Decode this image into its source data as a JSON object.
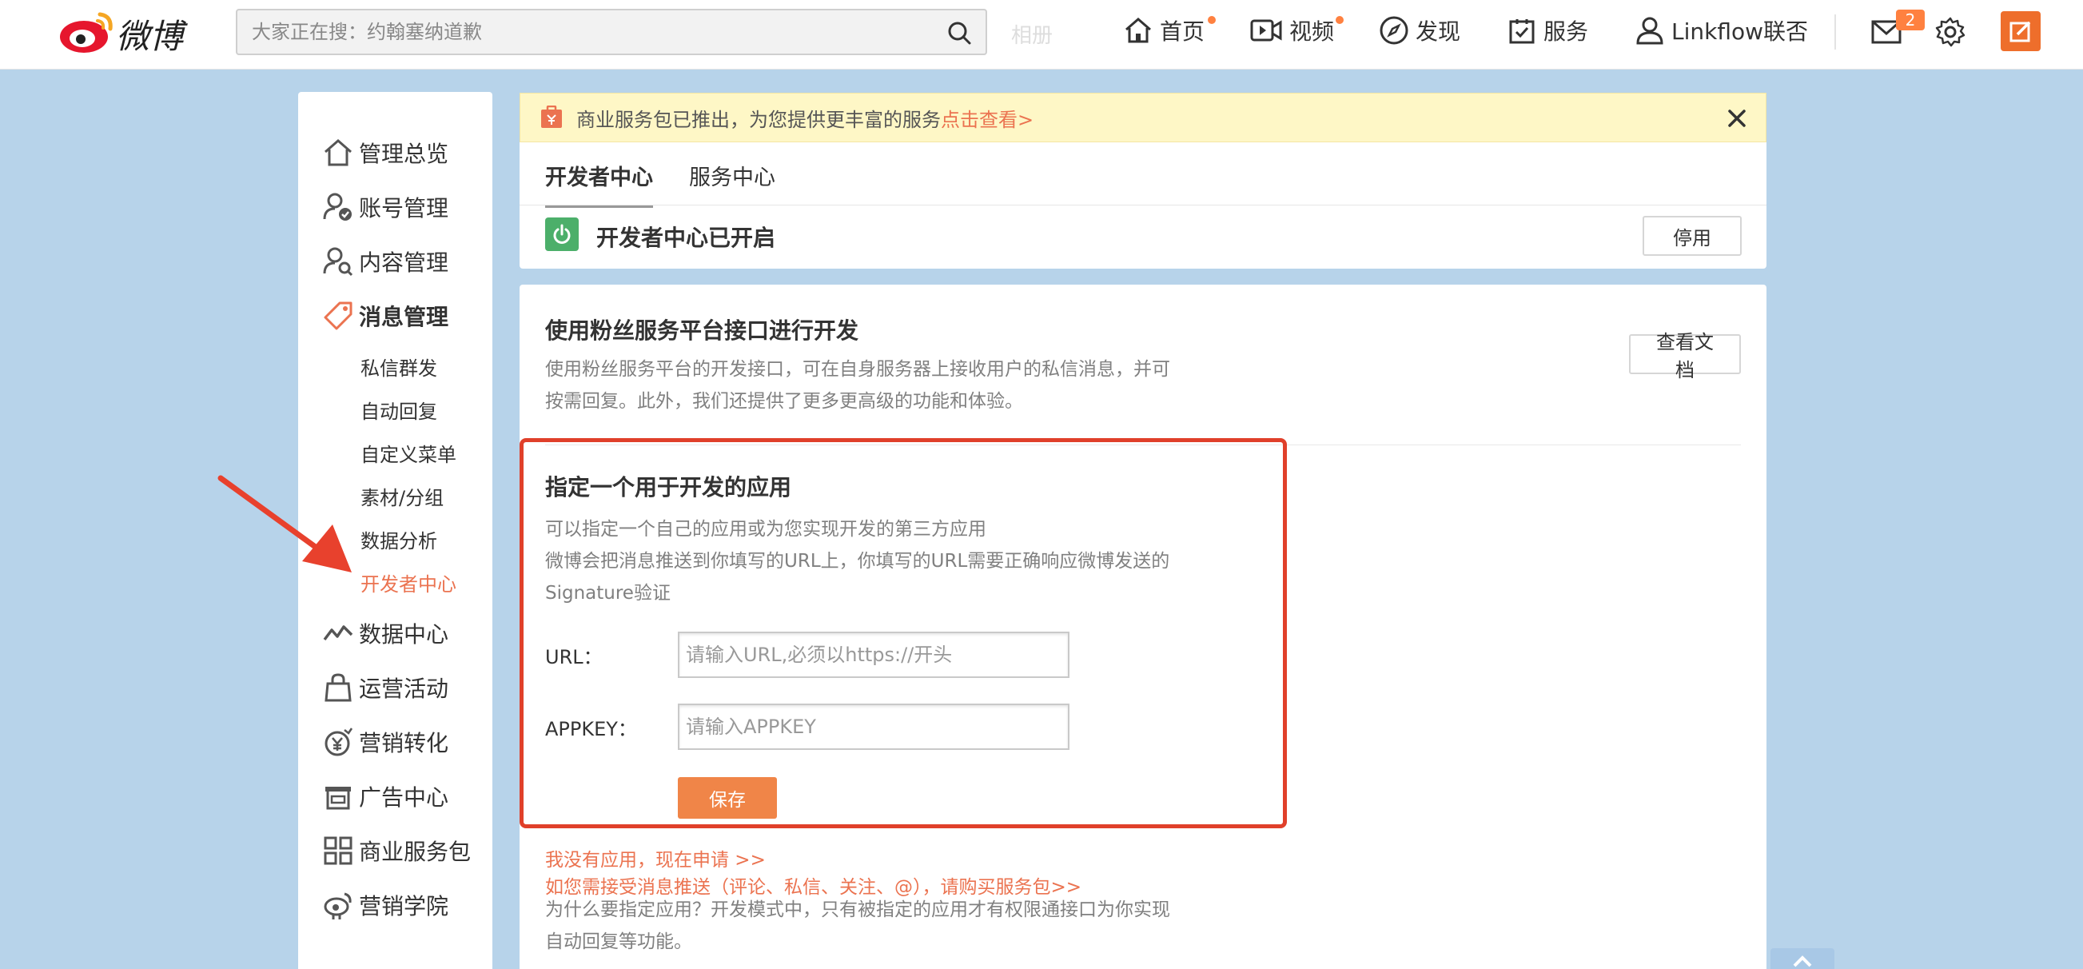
{
  "topbar": {
    "logo_text": "微博",
    "search_placeholder": "大家正在搜：约翰塞纳道歉",
    "ghost_tab": "相册",
    "nav": {
      "home": "首页",
      "video": "视频",
      "discover": "发现",
      "service": "服务",
      "user": "Linkflow联否"
    },
    "message_count": "2",
    "accent": "#ff8140"
  },
  "sidebar": {
    "items": [
      {
        "label": "管理总览"
      },
      {
        "label": "账号管理"
      },
      {
        "label": "内容管理"
      },
      {
        "label": "消息管理"
      }
    ],
    "sub_items": [
      {
        "label": "私信群发"
      },
      {
        "label": "自动回复"
      },
      {
        "label": "自定义菜单"
      },
      {
        "label": "素材/分组"
      },
      {
        "label": "数据分析"
      },
      {
        "label": "开发者中心"
      }
    ],
    "items_bottom": [
      {
        "label": "数据中心"
      },
      {
        "label": "运营活动"
      },
      {
        "label": "营销转化"
      },
      {
        "label": "广告中心"
      },
      {
        "label": "商业服务包"
      },
      {
        "label": "营销学院"
      }
    ]
  },
  "notice": {
    "text": "商业服务包已推出，为您提供更丰富的服务",
    "link": "点击查看>"
  },
  "tabs": [
    {
      "label": "开发者中心"
    },
    {
      "label": "服务中心"
    }
  ],
  "status": {
    "text": "开发者中心已开启",
    "disable_button": "停用"
  },
  "intro": {
    "title": "使用粉丝服务平台接口进行开发",
    "desc_line1": "使用粉丝服务平台的开发接口，可在自身服务器上接收用户的私信消息，并可",
    "desc_line2": "按需回复。此外，我们还提供了更多更高级的功能和体验。",
    "docs_button": "查看文档"
  },
  "app_form": {
    "title": "指定一个用于开发的应用",
    "desc_line1": "可以指定一个自己的应用或为您实现开发的第三方应用",
    "desc_line2": "微博会把消息推送到你填写的URL上，你填写的URL需要正确响应微博发送的",
    "desc_line3": "Signature验证",
    "url_label": "URL：",
    "url_placeholder": "请输入URL,必须以https://开头",
    "appkey_label": "APPKEY：",
    "appkey_placeholder": "请输入APPKEY",
    "save_button": "保存"
  },
  "footer_links": {
    "apply": "我没有应用，现在申请 >>",
    "buy": "如您需接受消息推送（评论、私信、关注、@），请购买服务包>>",
    "why_line1": "为什么要指定应用？开发模式中，只有被指定的应用才有权限通接口为你实现",
    "why_line2": "自动回复等功能。"
  }
}
